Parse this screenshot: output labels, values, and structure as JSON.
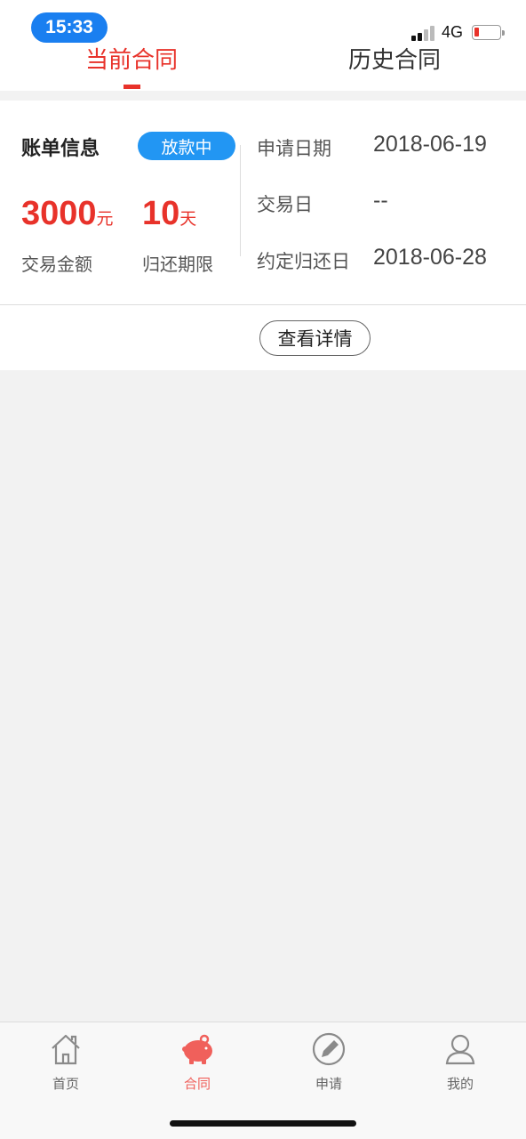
{
  "status_bar": {
    "time": "15:33",
    "network": "4G"
  },
  "tabs": [
    {
      "label": "当前合同",
      "active": true
    },
    {
      "label": "历史合同",
      "active": false
    }
  ],
  "contract": {
    "title": "账单信息",
    "status": "放款中",
    "amount": "3000",
    "amount_unit": "元",
    "amount_label": "交易金额",
    "term": "10",
    "term_unit": "天",
    "term_label": "归还期限",
    "info": [
      {
        "label": "申请日期",
        "value": "2018-06-19"
      },
      {
        "label": "交易日",
        "value": "--"
      },
      {
        "label": "约定归还日",
        "value": "2018-06-28"
      }
    ],
    "detail_button": "查看详情"
  },
  "nav": [
    {
      "label": "首页",
      "icon": "home-icon",
      "active": false
    },
    {
      "label": "合同",
      "icon": "piggy-bank-icon",
      "active": true
    },
    {
      "label": "申请",
      "icon": "pencil-circle-icon",
      "active": false
    },
    {
      "label": "我的",
      "icon": "user-icon",
      "active": false
    }
  ],
  "colors": {
    "accent": "#e8322a",
    "badge": "#2296f3",
    "time_pill": "#1a7ff0",
    "nav_active": "#f0605b"
  }
}
